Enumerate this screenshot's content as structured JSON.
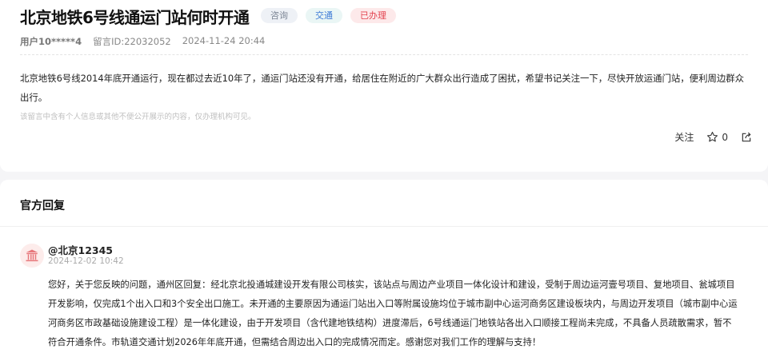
{
  "post": {
    "title": "北京地铁6号线通运门站何时开通",
    "tags": [
      {
        "label": "咨询"
      },
      {
        "label": "交通"
      },
      {
        "label": "已办理"
      }
    ],
    "user": "用户10*****4",
    "message_id": "留言ID:22032052",
    "datetime": "2024-11-24 20:44",
    "body_lines": [
      "北京地铁6号线2014年底开通运行，现在都过去近10年了，通运门站还没有开通，给居住在附近的广大群众出行造成了困扰，希望书记关注一下，尽快开放运通门站，便利周边群众",
      "出行。"
    ],
    "notice": "该留言中含有个人信息或其他不便公开展示的内容，仅办理机构可见。",
    "follow_label": "关注",
    "star_count": "0"
  },
  "reply": {
    "section_title": "官方回复",
    "author": "@北京12345",
    "datetime": "2024-12-02 10:42",
    "lines": [
      "您好，关于您反映的问题，通州区回复：经北京北投通城建设开发有限公司核实，该站点与周边产业项目一体化设计和建设，受制于周边运河壹号项目、复地项目、瓮城项目",
      "开发影响，仅完成1个出入口和3个安全出口施工。未开通的主要原因为通运门站出入口等附属设施均位于城市副中心运河商务区建设板块内，与周边开发项目（城市副中心运",
      "河商务区市政基础设施建设工程）是一体化建设，由于开发项目（含代建地铁结构）进度滞后，6号线通运门地铁站各出入口顺接工程尚未完成，不具备人员疏散需求，暂不",
      "符合开通条件。市轨道交通计划2026年年底开通，但需结合周边出入口的完成情况而定。感谢您对我们工作的理解与支持！"
    ]
  }
}
